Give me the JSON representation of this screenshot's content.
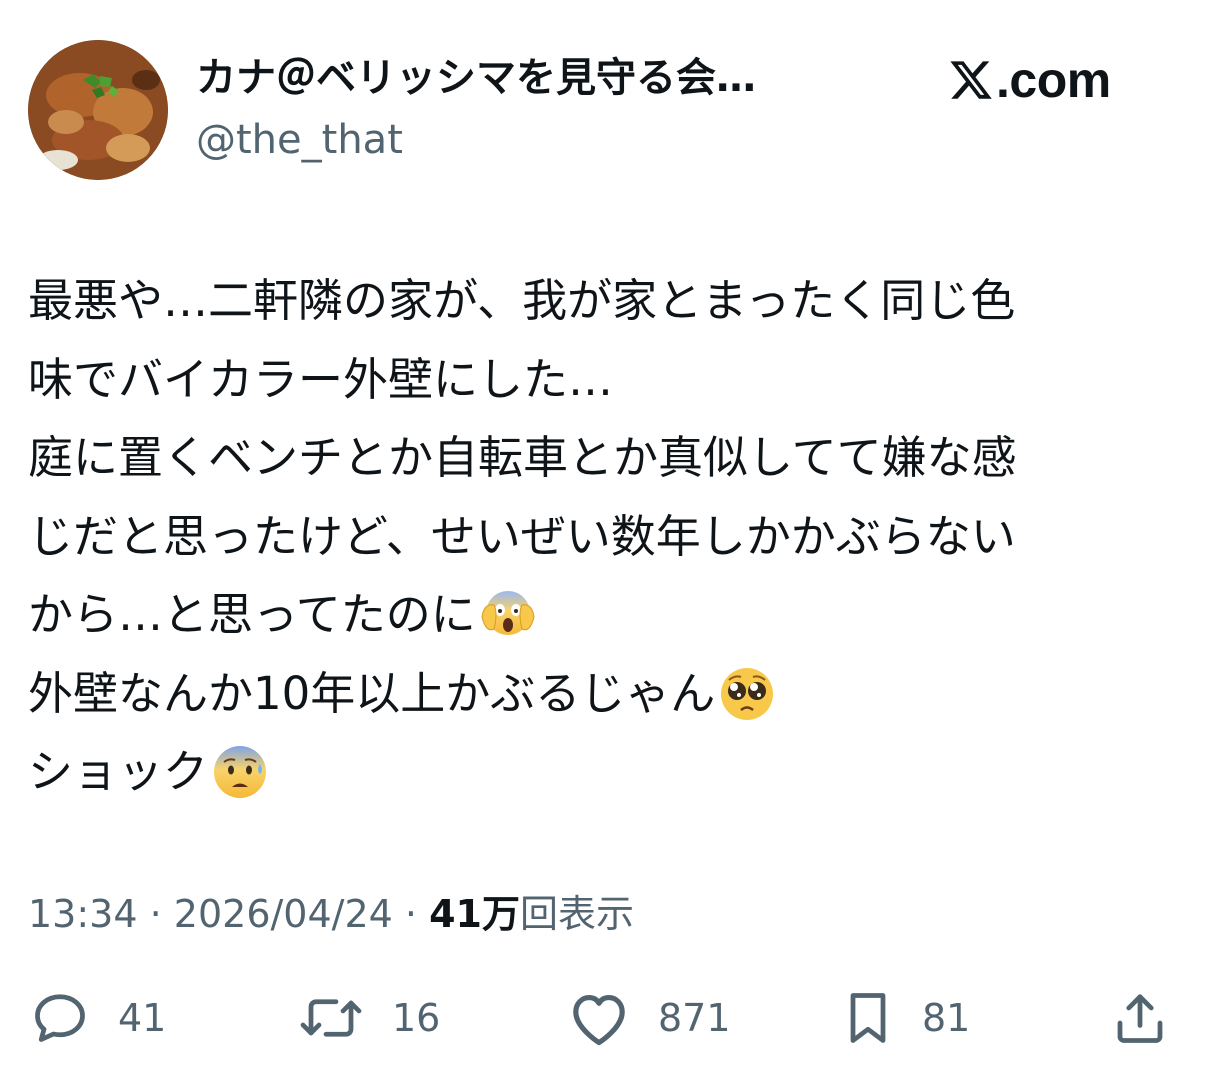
{
  "author": {
    "display_name": "カナ＠ベリッシマを見守る会…",
    "handle": "@the_that"
  },
  "brand": {
    "text": ".com"
  },
  "tweet": {
    "lines": [
      "最悪や…二軒隣の家が、我が家とまったく同じ色",
      "味でバイカラー外壁にした…",
      "庭に置くベンチとか自転車とか真似してて嫌な感",
      "じだと思ったけど、せいぜい数年しかかぶらない",
      "から…と思ってたのに",
      "外壁なんか10年以上かぶるじゃん",
      "ショック"
    ],
    "emojis": {
      "line5": "screaming-in-fear-emoji",
      "line6": "pleading-face-emoji",
      "line7": "anxious-face-emoji"
    }
  },
  "meta": {
    "time": "13:34",
    "separator": "·",
    "date": "2026/04/24",
    "views_count": "41万",
    "views_label": "回表示"
  },
  "actions": {
    "reply_count": "41",
    "retweet_count": "16",
    "like_count": "871",
    "bookmark_count": "81"
  },
  "colors": {
    "text": "#0f1419",
    "secondary": "#536471",
    "background": "#ffffff"
  }
}
